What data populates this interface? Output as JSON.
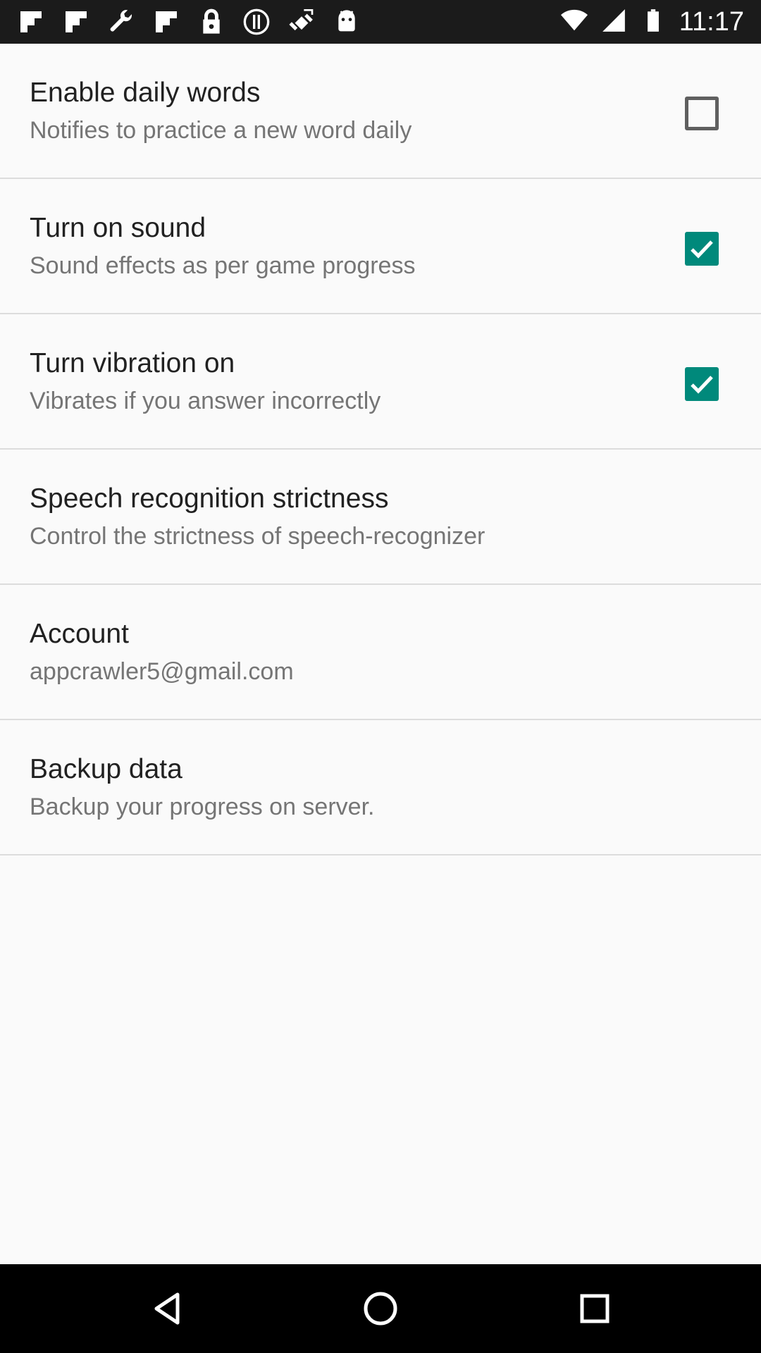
{
  "status_bar": {
    "time": "11:17",
    "left_icons": [
      "flipboard-icon",
      "flipboard-icon",
      "wrench-icon",
      "flipboard-icon",
      "lock-icon",
      "alert-circle-icon",
      "fake-gps-icon",
      "android-icon"
    ],
    "right_icons": [
      "wifi-icon",
      "signal-icon",
      "battery-icon"
    ]
  },
  "settings": [
    {
      "title": "Enable daily words",
      "summary": "Notifies to practice a new word daily",
      "checkbox": "unchecked"
    },
    {
      "title": "Turn on sound",
      "summary": "Sound effects as per game progress",
      "checkbox": "checked"
    },
    {
      "title": "Turn vibration on",
      "summary": "Vibrates if you answer incorrectly",
      "checkbox": "checked"
    },
    {
      "title": "Speech recognition strictness",
      "summary": "Control the strictness of speech-recognizer"
    },
    {
      "title": "Account",
      "summary": "appcrawler5@gmail.com"
    },
    {
      "title": "Backup data",
      "summary": "Backup your progress on server."
    }
  ],
  "colors": {
    "checkbox_checked": "#00897b",
    "checkbox_unchecked_border": "#5f5f5f",
    "title_text": "#212121",
    "summary_text": "#757575"
  },
  "nav_bar": [
    "back-icon",
    "home-icon",
    "recents-icon"
  ]
}
